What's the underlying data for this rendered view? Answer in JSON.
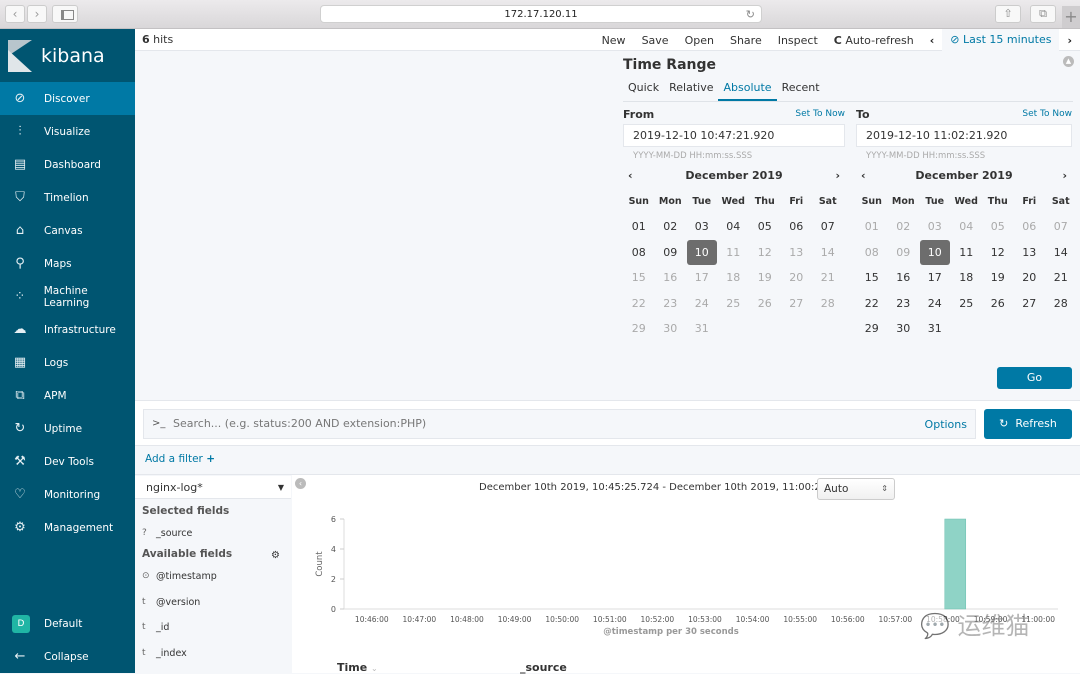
{
  "browser": {
    "url": "172.17.120.11",
    "back_icon": "‹",
    "forward_icon": "›"
  },
  "sidebar": {
    "logo_text": "kibana",
    "items": [
      {
        "label": "Discover",
        "icon": "⊘",
        "active": true
      },
      {
        "label": "Visualize",
        "icon": "⫶"
      },
      {
        "label": "Dashboard",
        "icon": "▤"
      },
      {
        "label": "Timelion",
        "icon": "⛉"
      },
      {
        "label": "Canvas",
        "icon": "⌂"
      },
      {
        "label": "Maps",
        "icon": "⚲"
      },
      {
        "label": "Machine Learning",
        "icon": "⁘"
      },
      {
        "label": "Infrastructure",
        "icon": "☁"
      },
      {
        "label": "Logs",
        "icon": "▦"
      },
      {
        "label": "APM",
        "icon": "⧉"
      },
      {
        "label": "Uptime",
        "icon": "↻"
      },
      {
        "label": "Dev Tools",
        "icon": "⚒"
      },
      {
        "label": "Monitoring",
        "icon": "♡"
      },
      {
        "label": "Management",
        "icon": "⚙"
      }
    ],
    "space": {
      "avatar": "D",
      "label": "Default"
    },
    "collapse": {
      "icon": "←",
      "label": "Collapse"
    }
  },
  "topbar": {
    "hits_count": "6",
    "hits_label": "hits",
    "menu": [
      "New",
      "Save",
      "Open",
      "Share",
      "Inspect"
    ],
    "auto_refresh": "Auto-refresh",
    "auto_refresh_icon": "C",
    "prev_icon": "‹",
    "next_icon": "›",
    "time_icon": "⊘",
    "time_label": "Last 15 minutes"
  },
  "time_range": {
    "title": "Time Range",
    "tabs": [
      {
        "label": "Quick"
      },
      {
        "label": "Relative"
      },
      {
        "label": "Absolute",
        "active": true
      },
      {
        "label": "Recent"
      }
    ],
    "from": {
      "label": "From",
      "set_now": "Set To Now",
      "value": "2019-12-10 10:47:21.920",
      "format": "YYYY-MM-DD HH:mm:ss.SSS",
      "month": "December 2019",
      "selected_day": "10",
      "muted_after": 10
    },
    "to": {
      "label": "To",
      "set_now": "Set To Now",
      "value": "2019-12-10 11:02:21.920",
      "format": "YYYY-MM-DD HH:mm:ss.SSS",
      "month": "December 2019",
      "selected_day": "10",
      "muted_before": 10
    },
    "weekdays": [
      "Sun",
      "Mon",
      "Tue",
      "Wed",
      "Thu",
      "Fri",
      "Sat"
    ],
    "days": [
      "01",
      "02",
      "03",
      "04",
      "05",
      "06",
      "07",
      "08",
      "09",
      "10",
      "11",
      "12",
      "13",
      "14",
      "15",
      "16",
      "17",
      "18",
      "19",
      "20",
      "21",
      "22",
      "23",
      "24",
      "25",
      "26",
      "27",
      "28",
      "29",
      "30",
      "31"
    ],
    "go_label": "Go"
  },
  "query": {
    "prompt": ">_",
    "placeholder": "Search... (e.g. status:200 AND extension:PHP)",
    "options_label": "Options",
    "refresh_label": "Refresh",
    "refresh_icon": "↻",
    "add_filter": "Add a filter",
    "add_filter_icon": "+"
  },
  "fields": {
    "index_pattern": "nginx-log*",
    "selected_heading": "Selected fields",
    "selected": [
      {
        "type": "?",
        "name": "_source"
      }
    ],
    "available_heading": "Available fields",
    "available": [
      {
        "type": "⊙",
        "name": "@timestamp"
      },
      {
        "type": "t",
        "name": "@version"
      },
      {
        "type": "t",
        "name": "_id"
      },
      {
        "type": "t",
        "name": "_index"
      }
    ]
  },
  "histogram": {
    "range_text": "December 10th 2019, 10:45:25.724 - December 10th 2019, 11:00:25.724 —",
    "interval": "Auto"
  },
  "chart_data": {
    "type": "bar",
    "title": "",
    "xlabel": "@timestamp per 30 seconds",
    "ylabel": "Count",
    "ylim": [
      0,
      6
    ],
    "yticks": [
      0,
      2,
      4,
      6
    ],
    "xlim": [
      "10:45:25",
      "11:00:25"
    ],
    "xticks": [
      "10:46:00",
      "10:47:00",
      "10:48:00",
      "10:49:00",
      "10:50:00",
      "10:51:00",
      "10:52:00",
      "10:53:00",
      "10:54:00",
      "10:55:00",
      "10:56:00",
      "10:57:00",
      "10:58:00",
      "10:59:00",
      "11:00:00"
    ],
    "bar_color": "#8fd3c6",
    "series": [
      {
        "name": "Count",
        "x": [
          "10:58:30"
        ],
        "values": [
          6
        ]
      }
    ]
  },
  "results": {
    "columns": [
      "Time",
      "_source"
    ]
  },
  "watermark": "运维猫"
}
